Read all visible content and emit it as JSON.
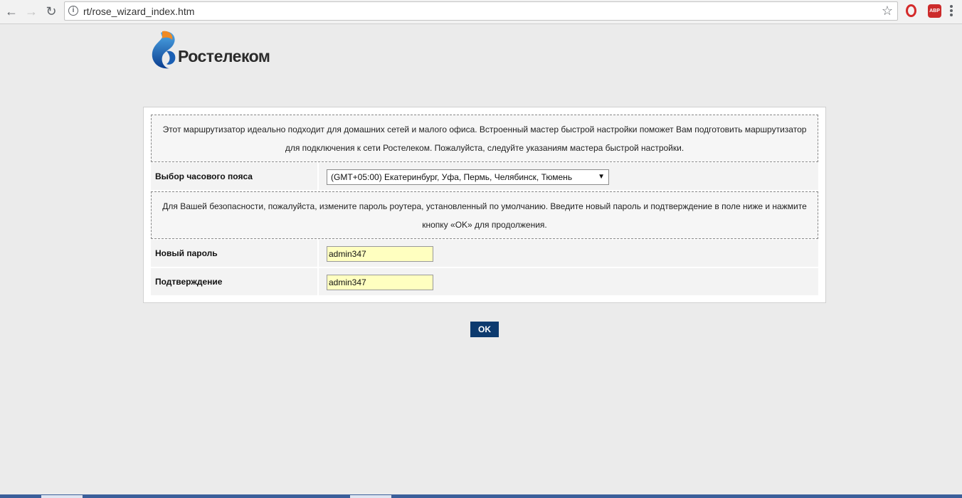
{
  "browser": {
    "url": "rt/rose_wizard_index.htm",
    "back_icon": "←",
    "forward_icon": "→",
    "reload_icon": "↻",
    "star_icon": "☆",
    "abp_label": "ABP"
  },
  "logo": {
    "text": "Ростелеком"
  },
  "wizard": {
    "intro_text": "Этот маршрутизатор идеально подходит для домашних сетей и малого офиса. Встроенный мастер быстрой настройки поможет Вам подготовить маршрутизатор для подключения к сети Ростелеком. Пожалуйста, следуйте указаниям мастера быстрой настройки.",
    "timezone_label": "Выбор часового пояса",
    "timezone_value": "(GMT+05:00) Екатеринбург, Уфа, Пермь, Челябинск, Тюмень",
    "security_text": "Для Вашей безопасности, пожалуйста, измените пароль роутера, установленный по умолчанию. Введите новый пароль и подтверждение в поле ниже и нажмите кнопку «OK» для продолжения.",
    "new_password_label": "Новый пароль",
    "new_password_value": "admin347",
    "confirm_label": "Подтверждение",
    "confirm_value": "admin347",
    "ok_label": "OK"
  },
  "colors": {
    "accent": "#0d3a6e",
    "input_bg": "#ffffc0",
    "page_bg": "#ebebeb"
  }
}
